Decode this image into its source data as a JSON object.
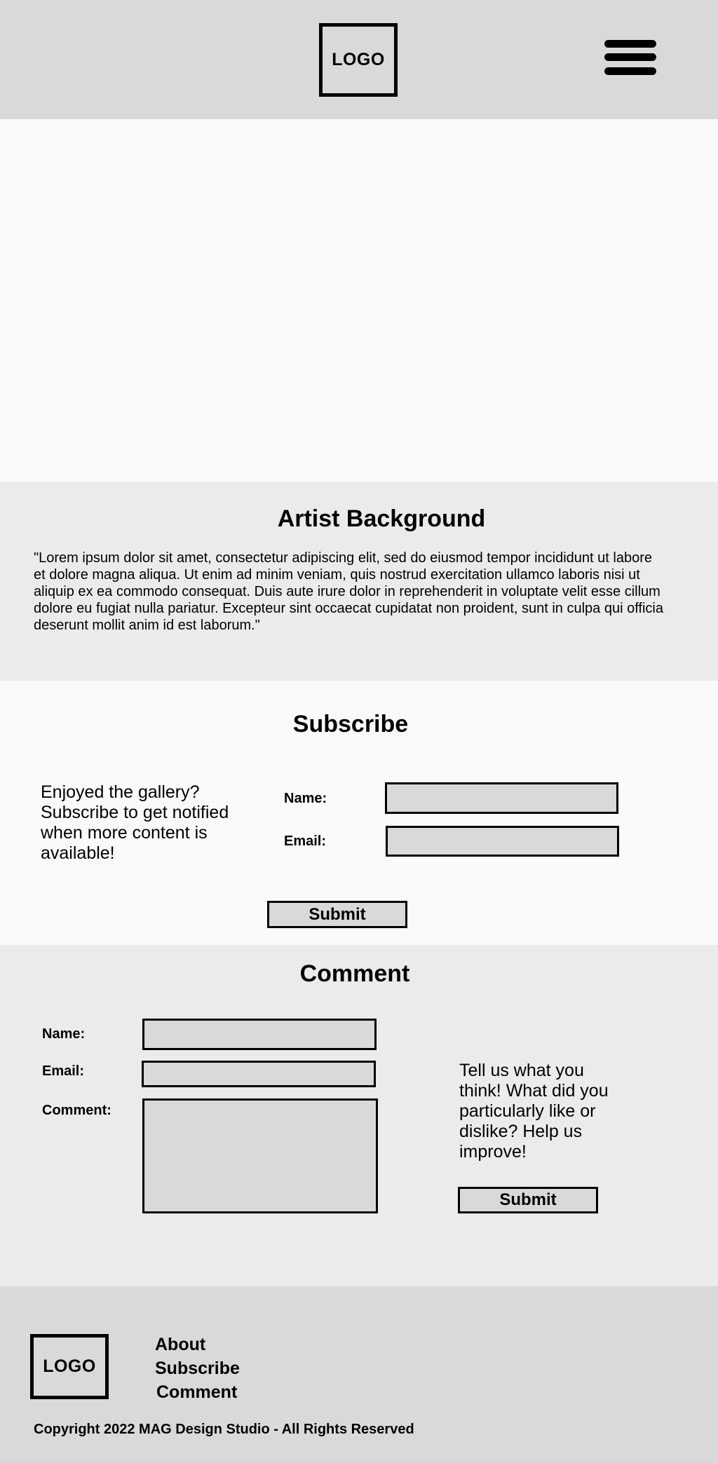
{
  "header": {
    "logo_text": "LOGO",
    "menu_icon": "hamburger-menu-icon"
  },
  "artist": {
    "title": "Artist Background",
    "text": "\"Lorem ipsum dolor sit amet, consectetur adipiscing elit, sed do eiusmod tempor incididunt ut labore et dolore magna aliqua. Ut enim ad minim veniam, quis nostrud exercitation ullamco laboris nisi ut aliquip ex ea commodo consequat. Duis aute irure dolor in reprehenderit in voluptate velit esse cillum dolore eu fugiat nulla pariatur. Excepteur sint occaecat cupidatat non proident, sunt in culpa qui officia deserunt mollit anim id est laborum.\""
  },
  "subscribe": {
    "title": "Subscribe",
    "blurb": "Enjoyed the gallery? Subscribe to get notified when more content is available!",
    "name_label": "Name:",
    "email_label": "Email:",
    "submit_label": "Submit"
  },
  "comment": {
    "title": "Comment",
    "name_label": "Name:",
    "email_label": "Email:",
    "comment_label": "Comment:",
    "blurb": "Tell us what you think!  What did you particularly like or dislike? Help us improve!",
    "submit_label": "Submit"
  },
  "footer": {
    "logo_text": "LOGO",
    "links": [
      "About",
      "Subscribe",
      "Comment"
    ],
    "copyright": "Copyright 2022 MAG Design Studio -  All Rights Reserved"
  }
}
